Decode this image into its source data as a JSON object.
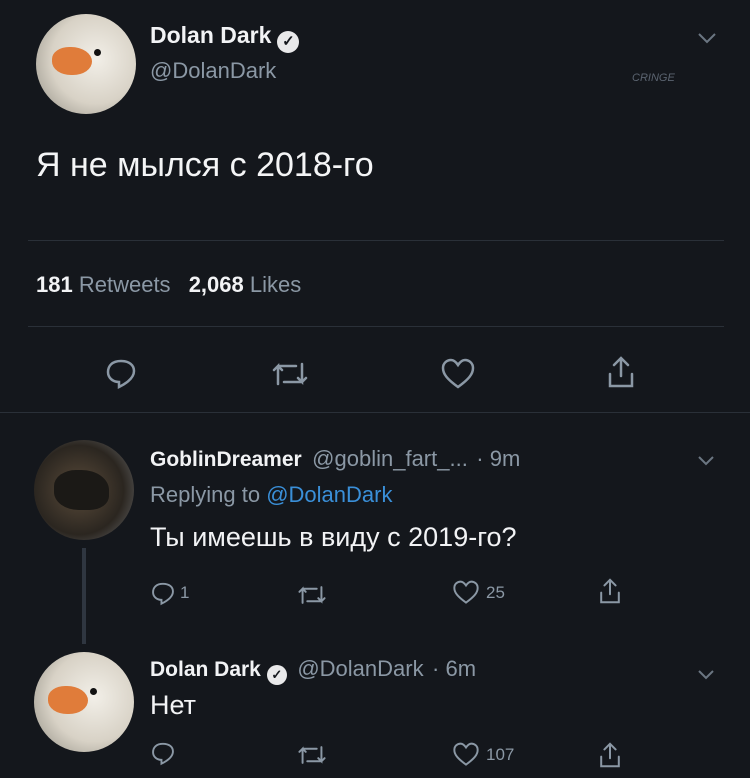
{
  "tweet": {
    "author_name": "Dolan Dark",
    "author_handle": "@DolanDark",
    "text": "Я не мылся с 2018-го",
    "retweets_count": "181",
    "retweets_label": "Retweets",
    "likes_count": "2,068",
    "likes_label": "Likes",
    "watermark": "CRINGE"
  },
  "reply1": {
    "author_name": "GoblinDreamer",
    "author_handle": "@goblin_fart_...",
    "time": "· 9m",
    "replying_label": "Replying to",
    "replying_handle": "@DolanDark",
    "text": "Ты имеешь в виду с 2019-го?",
    "reply_count": "1",
    "like_count": "25"
  },
  "reply2": {
    "author_name": "Dolan Dark",
    "author_handle": "@DolanDark",
    "time": "· 6m",
    "text": "Нет",
    "like_count": "107"
  },
  "icons": {
    "reply": "reply-icon",
    "retweet": "retweet-icon",
    "like": "heart-icon",
    "share": "share-icon",
    "chevron": "chevron-down-icon",
    "verified": "verified-badge-icon"
  }
}
